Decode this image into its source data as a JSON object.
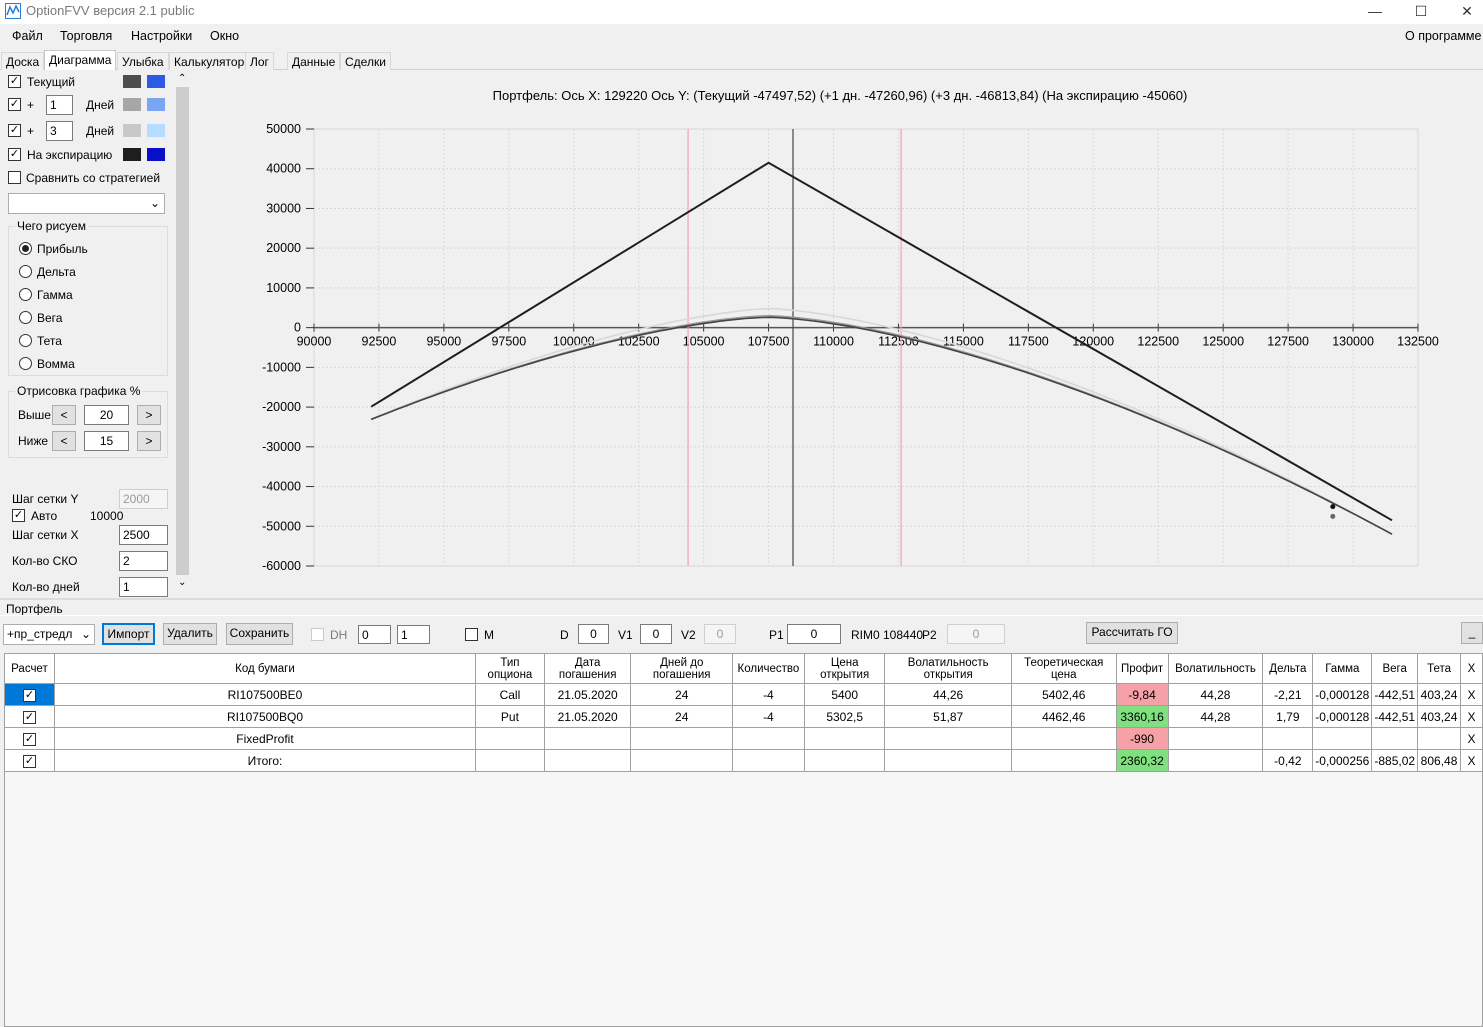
{
  "window": {
    "title": "OptionFVV версия 2.1 public"
  },
  "menu": {
    "items": [
      "Файл",
      "Торговля",
      "Настройки",
      "Окно"
    ],
    "about": "О программе"
  },
  "tabs": [
    "Доска",
    "Диаграмма",
    "Улыбка",
    "Калькулятор",
    "Лог",
    "Данные",
    "Сделки"
  ],
  "left": {
    "current": "Текущий",
    "plus": "+",
    "days1": "1",
    "days2": "3",
    "days_label": "Дней",
    "expiry": "На экспирацию",
    "compare": "Сравнить со стратегией",
    "group_what": "Чего рисуем",
    "options": [
      "Прибыль",
      "Дельта",
      "Гамма",
      "Вега",
      "Тета",
      "Вомма"
    ],
    "group_draw": "Отрисовка графика %",
    "above": "Выше",
    "below": "Ниже",
    "above_val": "20",
    "below_val": "15",
    "lt": "<",
    "gt": ">",
    "grid_y": "Шаг сетки Y",
    "grid_y_val": "2000",
    "auto": "Авто",
    "auto_val": "10000",
    "grid_x": "Шаг сетки X",
    "grid_x_val": "2500",
    "sko": "Кол-во СКО",
    "sko_val": "2",
    "days_count": "Кол-во дней",
    "days_count_val": "1",
    "colors": [
      "#4d4d4d",
      "#2d5be3",
      "#a6a6a6",
      "#7aa5f3",
      "#c8c8c8",
      "#b6dcff",
      "#1e1e1e",
      "#0a10c8"
    ]
  },
  "chart_data": {
    "type": "line",
    "title": "Портфель:  Ось X:  129220  Ось Y:   (Текущий  -47497,52)   (+1 дн.  -47260,96)   (+3 дн.  -46813,84)   (На экспирацию  -45060)",
    "xlim": [
      90000,
      132500
    ],
    "ylim": [
      -60000,
      50000
    ],
    "xticks": [
      "90000",
      "92500",
      "95000",
      "97500",
      "100000",
      "102500",
      "105000",
      "107500",
      "110000",
      "112500",
      "115000",
      "117500",
      "120000",
      "122500",
      "125000",
      "127500",
      "130000",
      "132500"
    ],
    "yticks": [
      "50000",
      "40000",
      "30000",
      "20000",
      "10000",
      "0",
      "-10000",
      "-20000",
      "-30000",
      "-40000",
      "-50000",
      "-60000"
    ],
    "xtick_values": [
      90000,
      92500,
      95000,
      97500,
      100000,
      102500,
      105000,
      107500,
      110000,
      112500,
      115000,
      117500,
      120000,
      122500,
      125000,
      127500,
      130000,
      132500
    ],
    "ytick_values": [
      50000,
      40000,
      30000,
      20000,
      10000,
      0,
      -10000,
      -20000,
      -30000,
      -40000,
      -50000,
      -60000
    ],
    "vlines": [
      {
        "x": 104400,
        "color": "#f4a0b4"
      },
      {
        "x": 108440,
        "color": "#445"
      },
      {
        "x": 112600,
        "color": "#f4a0b4"
      }
    ],
    "expiry_points": [
      [
        92200,
        -19900
      ],
      [
        107500,
        41500
      ],
      [
        131500,
        -48500
      ]
    ],
    "current_peak": [
      107500,
      2600
    ],
    "marker_x": 129220,
    "series": [
      {
        "color": "#d8d8d8",
        "offset": 2200
      },
      {
        "color": "#9a9a9a",
        "offset": 400
      },
      {
        "color": "#444444",
        "offset": 0
      }
    ]
  },
  "portfolio": {
    "label": "Портфель",
    "strategy": "+пр_стредл",
    "import": "Импорт",
    "delete": "Удалить",
    "save": "Сохранить",
    "dh": "DH",
    "dh1": "0",
    "dh2": "1",
    "m": "M",
    "d": "D",
    "d_val": "0",
    "v1": "V1",
    "v1_val": "0",
    "v2": "V2",
    "v2_val": "0",
    "p1": "P1",
    "p1_val": "0",
    "rim": "RIM0 108440",
    "p2": "P2",
    "p2_val": "0",
    "calc": "Рассчитать ГО",
    "min": "_"
  },
  "table": {
    "headers": [
      "Расчет",
      "Код бумаги",
      "Тип опциона",
      "Дата погашения",
      "Дней до погашения",
      "Количество",
      "Цена открытия",
      "Волатильность открытия",
      "Теоретическая цена",
      "Профит",
      "Волатильность",
      "Дельта",
      "Гамма",
      "Вега",
      "Тета",
      "X"
    ],
    "rows": [
      [
        "RI107500BE0",
        "Call",
        "21.05.2020",
        "24",
        "-4",
        "5400",
        "44,26",
        "5402,46",
        "-9,84",
        "44,28",
        "-2,21",
        "-0,000128",
        "-442,51",
        "403,24",
        "X"
      ],
      [
        "RI107500BQ0",
        "Put",
        "21.05.2020",
        "24",
        "-4",
        "5302,5",
        "51,87",
        "4462,46",
        "3360,16",
        "44,28",
        "1,79",
        "-0,000128",
        "-442,51",
        "403,24",
        "X"
      ],
      [
        "FixedProfit",
        "",
        "",
        "",
        "",
        "",
        "",
        "",
        "-990",
        "",
        "",
        "",
        "",
        "",
        "X"
      ],
      [
        "Итого:",
        "",
        "",
        "",
        "",
        "",
        "",
        "",
        "2360,32",
        "",
        "-0,42",
        "-0,000256",
        "-885,02",
        "806,48",
        "X"
      ]
    ]
  }
}
